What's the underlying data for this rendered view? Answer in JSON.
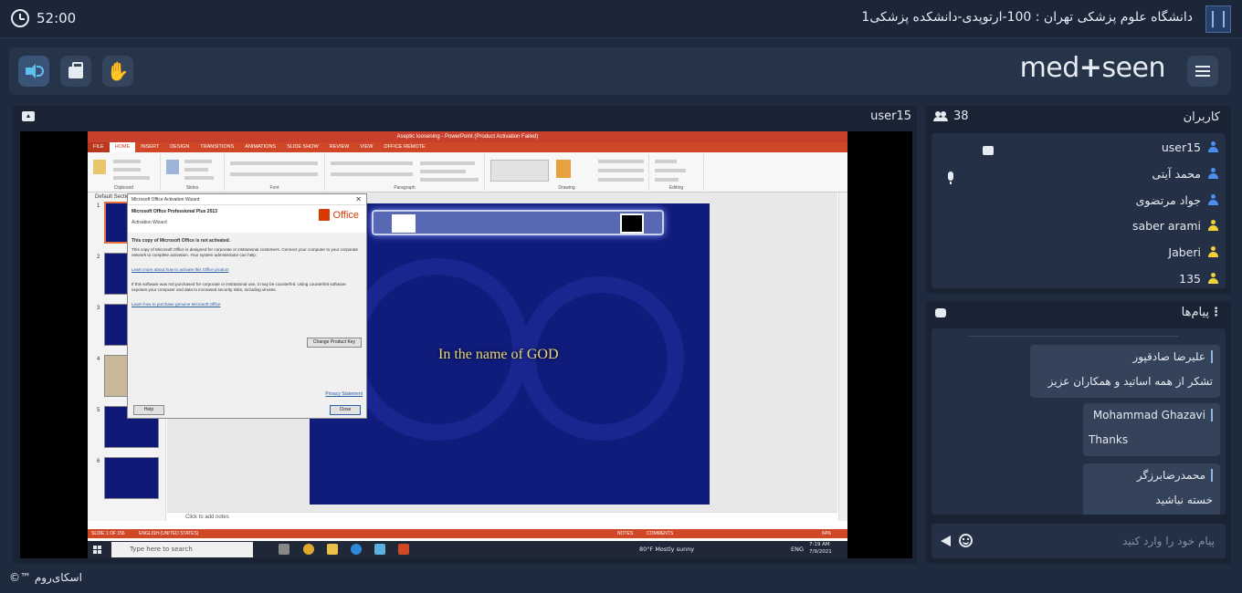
{
  "timer": "52:00",
  "room_title": "دانشگاه علوم پزشکی تهران : 100-ارتوپدی-دانشکده پزشکی1",
  "brand": {
    "left": "med",
    "right": "seen"
  },
  "presenter": "user15",
  "users_panel": {
    "title": "کاربران",
    "count": "38",
    "users": [
      {
        "name": "user15",
        "role_color": "#4a8ff0"
      },
      {
        "name": "محمد آیتی",
        "role_color": "#4a8ff0"
      },
      {
        "name": "جواد مرتضوی",
        "role_color": "#4a8ff0"
      },
      {
        "name": "saber arami",
        "role_color": "#f0d236"
      },
      {
        "name": "Jaberi",
        "role_color": "#f0d236"
      },
      {
        "name": "135",
        "role_color": "#f0d236"
      }
    ]
  },
  "chat": {
    "title": "پیام‌ها",
    "messages": [
      {
        "sender": "علیرضا صادقپور",
        "text": "تشکر از همه اساتید و همکاران عزیز"
      },
      {
        "sender": "Mohammad Ghazavi",
        "text": "Thanks"
      },
      {
        "sender": "محمدرضابرزگر",
        "text": "خسته نباشید"
      }
    ],
    "input_placeholder": "پیام خود را وارد کنید"
  },
  "footer": "اسکای‌روم ™©",
  "shared_screen": {
    "window_title": "Aseptic loosening - PowerPoint (Product Activation Failed)",
    "tabs": [
      "FILE",
      "HOME",
      "INSERT",
      "DESIGN",
      "TRANSITIONS",
      "ANIMATIONS",
      "SLIDE SHOW",
      "REVIEW",
      "VIEW",
      "OFFICE REMOTE"
    ],
    "ribbon_groups": [
      "Clipboard",
      "Slides",
      "Font",
      "Paragraph",
      "Drawing",
      "Editing"
    ],
    "section_label": "Default Section",
    "slide_numbers": [
      "1",
      "2",
      "3",
      "4",
      "5",
      "6"
    ],
    "slide_text": "In the name of GOD",
    "notes_placeholder": "Click to add notes",
    "status_left": "SLIDE 1 OF 156",
    "status_lang": "ENGLISH (UNITED STATES)",
    "status_notes": "NOTES",
    "status_comments": "COMMENTS",
    "zoom": "64%",
    "dialog": {
      "title": "Microsoft Office Activation Wizard",
      "product": "Microsoft Office Professional Plus 2013",
      "subtitle": "Activation Wizard",
      "office_label": "Office",
      "heading": "This copy of Microsoft Office is not activated.",
      "body": "This copy of Microsoft Office is designed for corporate or institutional customers. Connect your computer to your corporate network to complete activation. Your system administrator can help.",
      "link1": "Learn more about how to activate this Office product",
      "body2": "If this software was not purchased for corporate or institutional use, it may be counterfeit. Using counterfeit software exposes your computer and data to increased security risks, including viruses.",
      "link2": "Learn how to purchase genuine Microsoft Office",
      "change_key": "Change Product Key",
      "privacy": "Privacy Statement",
      "help": "Help",
      "close": "Close"
    },
    "taskbar": {
      "search_placeholder": "Type here to search",
      "weather": "80°F  Mostly sunny",
      "lang": "ENG",
      "time": "7:19 AM",
      "date": "7/9/2021"
    }
  }
}
